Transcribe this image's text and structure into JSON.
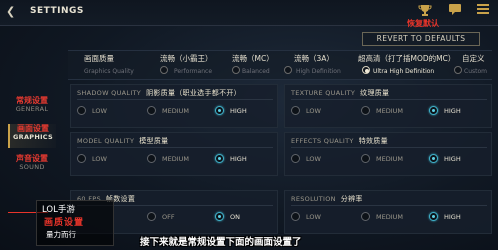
{
  "header": {
    "title": "SETTINGS",
    "back_icon": "chevron-left-icon",
    "icons": [
      "trophy-icon",
      "chat-icon",
      "menu-icon"
    ],
    "reset_label_zh": "恢复默认"
  },
  "nav": [
    {
      "zh": "常规设置",
      "en": "GENERAL",
      "active": false
    },
    {
      "zh": "画面设置",
      "en": "GRAPHICS",
      "active": true
    },
    {
      "zh": "声音设置",
      "en": "SOUND",
      "active": false
    }
  ],
  "presets": {
    "revert_label": "REVERT TO DEFAULTS",
    "items": [
      {
        "zh": "画面质量",
        "en": "Graphics Quality",
        "radio": false
      },
      {
        "zh": "流畅（小霸王）",
        "en": "Performance",
        "radio": true,
        "selected": false
      },
      {
        "zh": "流畅（MC）",
        "en": "Balanced",
        "radio": true,
        "selected": false
      },
      {
        "zh": "流畅（3A）",
        "en": "High Definition",
        "radio": true,
        "selected": false
      },
      {
        "zh": "超高清（打了插MOD的MC）",
        "en": "Ultra High Definition",
        "radio": true,
        "selected": true
      },
      {
        "zh": "自定义",
        "en": "Custom",
        "radio": true,
        "selected": false
      }
    ]
  },
  "panels": [
    {
      "en": "SHADOW QUALITY",
      "zh": "阴影质量（职业选手都不开）",
      "options": [
        "LOW",
        "MEDIUM",
        "HIGH"
      ],
      "selected": 2
    },
    {
      "en": "TEXTURE QUALITY",
      "zh": "纹理质量",
      "options": [
        "LOW",
        "MEDIUM",
        "HIGH"
      ],
      "selected": 2
    },
    {
      "en": "MODEL QUALITY",
      "zh": "模型质量",
      "options": [
        "LOW",
        "MEDIUM",
        "HIGH"
      ],
      "selected": 2
    },
    {
      "en": "EFFECTS QUALITY",
      "zh": "特效质量",
      "options": [
        "LOW",
        "MEDIUM",
        "HIGH"
      ],
      "selected": 2
    },
    {
      "en": "60 FPS",
      "zh": "帧数设置",
      "options": [
        "OFF",
        "ON"
      ],
      "selected": 1
    },
    {
      "en": "RESOLUTION",
      "zh": "分辨率",
      "options": [
        "LOW",
        "MEDIUM",
        "HIGH"
      ],
      "selected": 2
    }
  ],
  "overlay": {
    "subtitle": "接下来就是常规设置下面的画面设置了",
    "watermark_line1": "LOL手游",
    "watermark_line2": "画质设置",
    "watermark_line3": "量力而行"
  },
  "colors": {
    "accent_red": "#e8342a",
    "accent_gold": "#c9a24a",
    "selected_cyan": "#5fd2e6"
  }
}
